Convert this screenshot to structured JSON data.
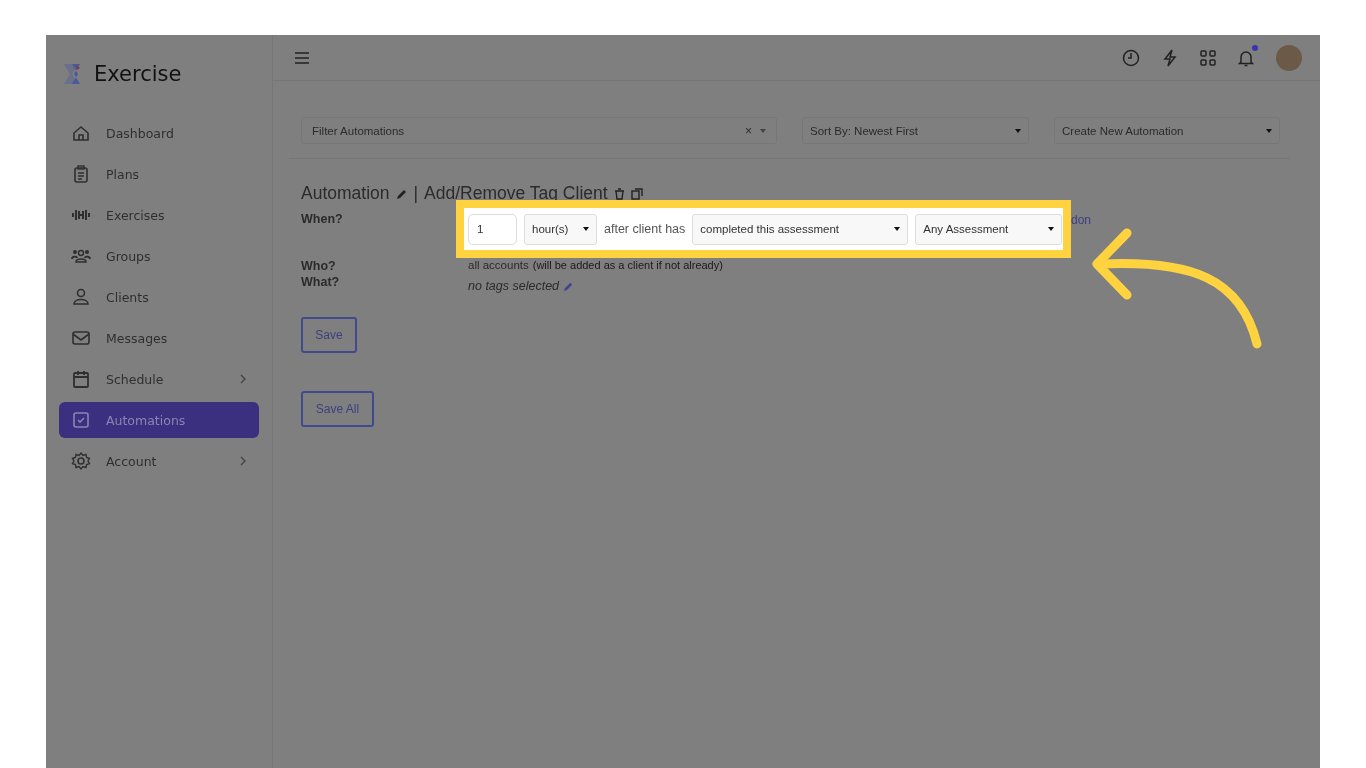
{
  "brand": {
    "name": "Exercise"
  },
  "sidebar": {
    "items": [
      {
        "label": "Dashboard",
        "selected": false,
        "has_submenu": false
      },
      {
        "label": "Plans",
        "selected": false,
        "has_submenu": false
      },
      {
        "label": "Exercises",
        "selected": false,
        "has_submenu": false
      },
      {
        "label": "Groups",
        "selected": false,
        "has_submenu": false
      },
      {
        "label": "Clients",
        "selected": false,
        "has_submenu": false
      },
      {
        "label": "Messages",
        "selected": false,
        "has_submenu": false
      },
      {
        "label": "Schedule",
        "selected": false,
        "has_submenu": true
      },
      {
        "label": "Automations",
        "selected": true,
        "has_submenu": false
      },
      {
        "label": "Account",
        "selected": false,
        "has_submenu": true
      }
    ]
  },
  "topbar": {
    "notifications_unread": true
  },
  "toolbar": {
    "filter": {
      "placeholder": "Filter Automations",
      "clear": "×"
    },
    "sort": {
      "value": "Sort By: Newest First"
    },
    "create": {
      "value": "Create New Automation"
    }
  },
  "automation": {
    "title": "Automation",
    "separator": "|",
    "name": "Add/Remove Tag Client",
    "when": {
      "label": "When?",
      "amount": "1",
      "unit": "hour(s)",
      "connector": "after client has",
      "event": "completed this assessment",
      "target": "Any Assessment",
      "done_link": "don"
    },
    "who": {
      "label": "Who?",
      "value": "all accounts",
      "note": "(will be added as a client if not already)"
    },
    "what": {
      "label": "What?",
      "value": "no tags selected"
    },
    "save": "Save"
  },
  "save_all": "Save All"
}
